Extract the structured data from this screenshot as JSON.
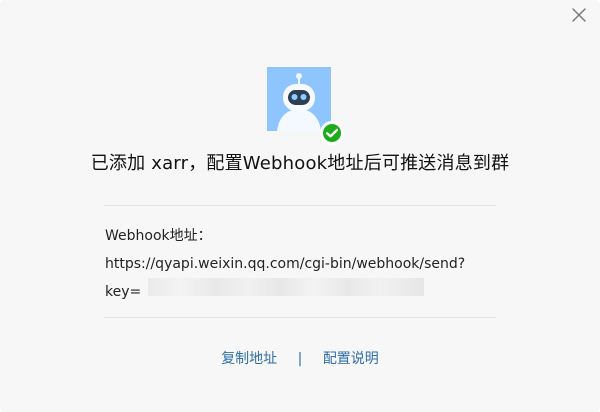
{
  "dialog": {
    "headline": "已添加 xarr，配置Webhook地址后可推送消息到群",
    "webhook_label": "Webhook地址：",
    "webhook_url_line1": "https://qyapi.weixin.qq.com/cgi-bin/webhook/send?",
    "webhook_url_key_prefix": "key=",
    "actions": {
      "copy_label": "复制地址",
      "separator": "|",
      "help_label": "配置说明"
    }
  },
  "colors": {
    "dialog_background": "#f7f7f7",
    "link": "#2f6ea7",
    "success_green": "#1aad19"
  },
  "icons": {
    "close": "close-icon",
    "avatar": "robot-avatar",
    "badge": "checkmark-icon"
  }
}
